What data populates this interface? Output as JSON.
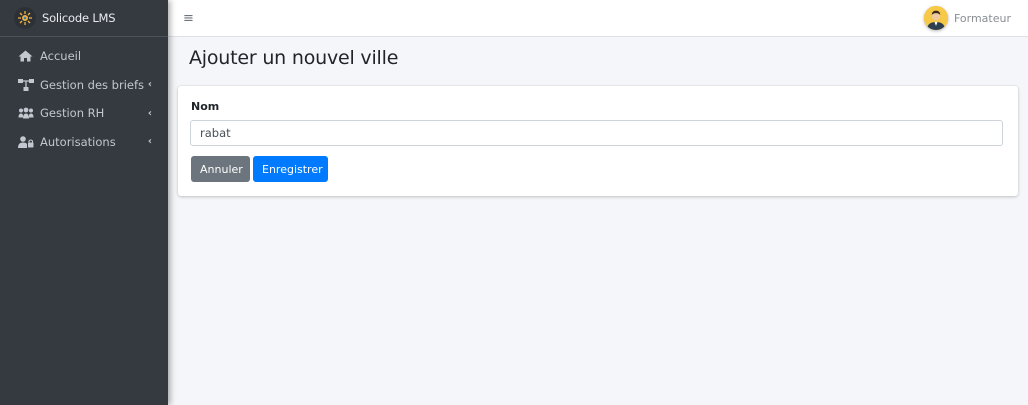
{
  "brand": {
    "name": "Solicode LMS",
    "logo_icon": "solicode-logo-icon"
  },
  "sidebar": {
    "items": [
      {
        "label": "Accueil",
        "icon": "home-icon",
        "has_submenu": false
      },
      {
        "label": "Gestion des briefs",
        "icon": "sitemap-icon",
        "has_submenu": true
      },
      {
        "label": "Gestion RH",
        "icon": "users-icon",
        "has_submenu": true
      },
      {
        "label": "Autorisations",
        "icon": "user-lock-icon",
        "has_submenu": true
      }
    ],
    "caret": "‹"
  },
  "topbar": {
    "menu_icon": "≡",
    "user_name": "Formateur"
  },
  "page": {
    "title": "Ajouter un nouvel ville"
  },
  "form": {
    "name_label": "Nom",
    "name_value": "rabat",
    "cancel_label": "Annuler",
    "save_label": "Enregistrer"
  },
  "colors": {
    "sidebar_bg": "#343a40",
    "primary": "#007bff",
    "secondary": "#6c757d",
    "content_bg": "#f4f6f9"
  }
}
